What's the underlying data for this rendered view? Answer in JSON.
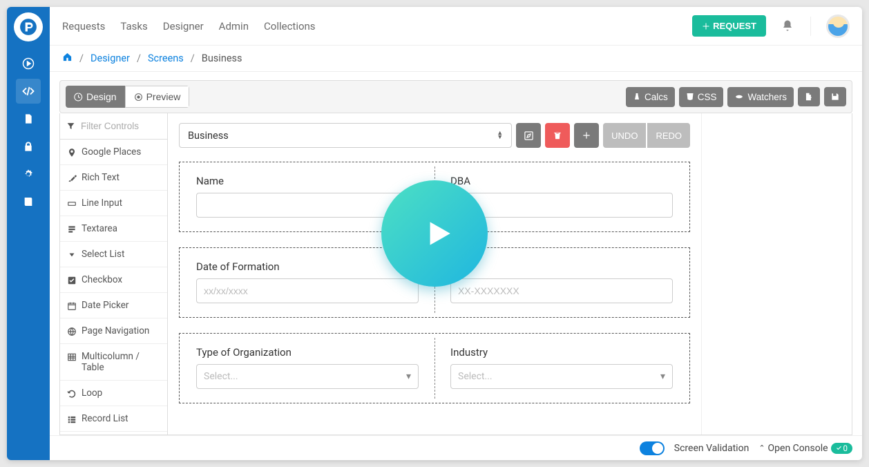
{
  "nav": {
    "items": [
      "Requests",
      "Tasks",
      "Designer",
      "Admin",
      "Collections"
    ],
    "request_btn": "REQUEST"
  },
  "breadcrumb": {
    "home": "home",
    "designer": "Designer",
    "screens": "Screens",
    "current": "Business"
  },
  "toolbar": {
    "design": "Design",
    "preview": "Preview",
    "calcs": "Calcs",
    "css": "CSS",
    "watchers": "Watchers"
  },
  "controls": {
    "filter_placeholder": "Filter Controls",
    "items": [
      "Google Places",
      "Rich Text",
      "Line Input",
      "Textarea",
      "Select List",
      "Checkbox",
      "Date Picker",
      "Page Navigation",
      "Multicolumn / Table",
      "Loop",
      "Record List"
    ]
  },
  "page": {
    "selected": "Business",
    "undo": "UNDO",
    "redo": "REDO"
  },
  "form": {
    "sections": [
      {
        "left": {
          "label": "Name",
          "placeholder": ""
        },
        "right": {
          "label": "DBA",
          "placeholder": ""
        }
      },
      {
        "left": {
          "label": "Date of Formation",
          "placeholder": "xx/xx/xxxx"
        },
        "right": {
          "label": "#",
          "placeholder": "XX-XXXXXXX"
        }
      },
      {
        "left": {
          "label": "Type of Organization",
          "placeholder": "Select...",
          "is_select": true
        },
        "right": {
          "label": "Industry",
          "placeholder": "Select...",
          "is_select": true
        }
      }
    ]
  },
  "status": {
    "screen_validation": "Screen Validation",
    "open_console": "Open Console",
    "count": "0"
  },
  "colors": {
    "brand": "#1572c2",
    "accent": "#1abc9c",
    "danger": "#ef5b5b"
  }
}
